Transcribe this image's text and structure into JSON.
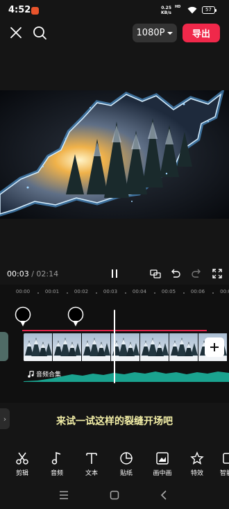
{
  "status_bar": {
    "time": "4:52",
    "net_speed": "0.25",
    "net_unit": "KB/s",
    "hd": "HD",
    "battery": "57"
  },
  "header": {
    "resolution": "1080P",
    "export_label": "导出"
  },
  "playback": {
    "current_time": "00:03",
    "separator": " / ",
    "total_time": "02:14"
  },
  "timeline": {
    "ruler_labels": [
      "00:00",
      "00:01",
      "00:02",
      "00:03",
      "00:04",
      "00:05",
      "00:06",
      "00:0"
    ],
    "audio_label": "音频合集"
  },
  "tip": "来试一试这样的裂缝开场吧",
  "toolbar": {
    "items": [
      {
        "label": "剪辑",
        "icon": "scissors-icon"
      },
      {
        "label": "音频",
        "icon": "music-note-icon"
      },
      {
        "label": "文本",
        "icon": "text-icon"
      },
      {
        "label": "贴纸",
        "icon": "sticker-icon"
      },
      {
        "label": "画中画",
        "icon": "picture-in-picture-icon"
      },
      {
        "label": "特效",
        "icon": "effects-star-icon"
      },
      {
        "label": "智能",
        "icon": "smart-icon"
      }
    ]
  },
  "colors": {
    "accent": "#f0284a",
    "audio_wave": "#1aa38f",
    "tip_text": "#f4f0a8"
  }
}
